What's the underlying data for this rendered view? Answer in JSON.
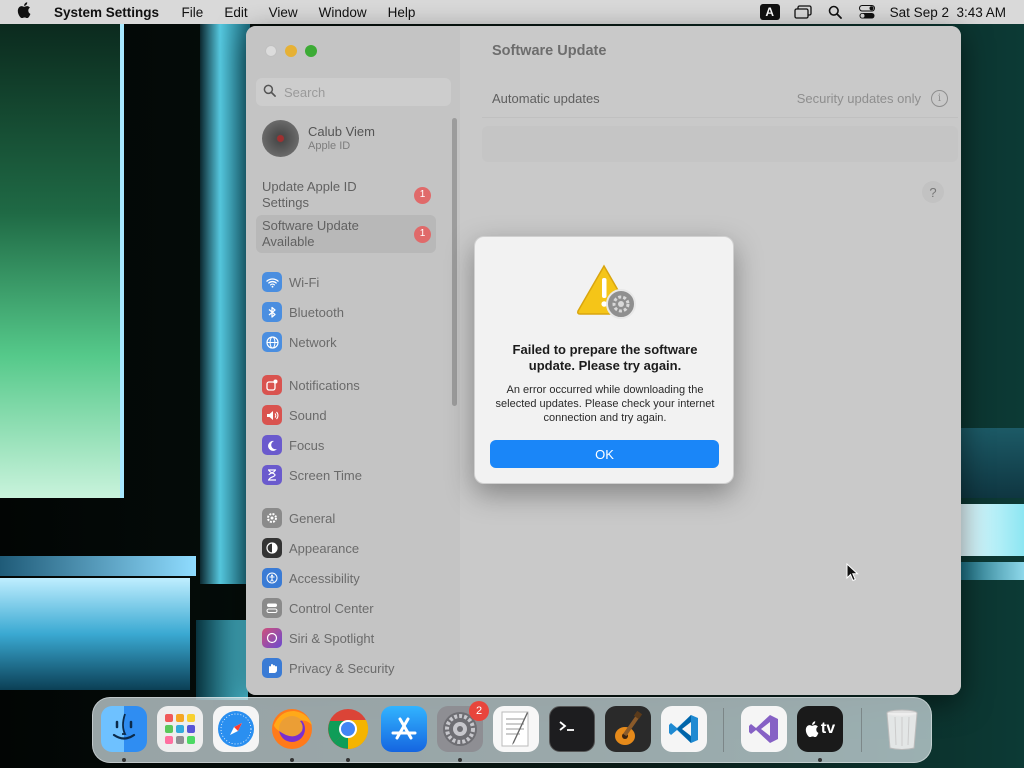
{
  "menubar": {
    "app_name": "System Settings",
    "menus": [
      "File",
      "Edit",
      "View",
      "Window",
      "Help"
    ],
    "input_source": "A",
    "clock": "Sat Sep 2  3:43 AM"
  },
  "sidebar": {
    "search_placeholder": "Search",
    "account": {
      "name": "Calub Viem",
      "subtitle": "Apple ID"
    },
    "alerts": [
      {
        "label_line1": "Update Apple ID",
        "label_line2": "Settings",
        "badge": "1"
      },
      {
        "label_line1": "Software Update",
        "label_line2": "Available",
        "badge": "1"
      }
    ],
    "group1": [
      {
        "label": "Wi-Fi",
        "icon": "wifi-icon",
        "color": "#4a8ee0"
      },
      {
        "label": "Bluetooth",
        "icon": "bluetooth-icon",
        "color": "#4a8ee0"
      },
      {
        "label": "Network",
        "icon": "network-icon",
        "color": "#4a8ee0"
      }
    ],
    "group2": [
      {
        "label": "Notifications",
        "icon": "notifications-icon",
        "color": "#d9534f"
      },
      {
        "label": "Sound",
        "icon": "sound-icon",
        "color": "#d9534f"
      },
      {
        "label": "Focus",
        "icon": "focus-icon",
        "color": "#6a5acd"
      },
      {
        "label": "Screen Time",
        "icon": "screen-time-icon",
        "color": "#6a5acd"
      }
    ],
    "group3": [
      {
        "label": "General",
        "icon": "general-icon",
        "color": "#8a8a8a"
      },
      {
        "label": "Appearance",
        "icon": "appearance-icon",
        "color": "#333333"
      },
      {
        "label": "Accessibility",
        "icon": "accessibility-icon",
        "color": "#3a7bd5"
      },
      {
        "label": "Control Center",
        "icon": "control-center-icon",
        "color": "#8a8a8a"
      },
      {
        "label": "Siri & Spotlight",
        "icon": "siri-icon",
        "color": "#b0508a"
      },
      {
        "label": "Privacy & Security",
        "icon": "privacy-icon",
        "color": "#3a7bd5"
      }
    ]
  },
  "main": {
    "title": "Software Update",
    "automatic_updates_label": "Automatic updates",
    "automatic_updates_value": "Security updates only",
    "help_label": "?"
  },
  "alert": {
    "title": "Failed to prepare the software update. Please try again.",
    "message": "An error occurred while downloading the selected updates. Please check your internet connection and try again.",
    "ok_label": "OK"
  },
  "dock": {
    "items": [
      {
        "name": "finder-icon",
        "running": true
      },
      {
        "name": "launchpad-icon",
        "running": false
      },
      {
        "name": "safari-icon",
        "running": false
      },
      {
        "name": "firefox-icon",
        "running": true
      },
      {
        "name": "chrome-icon",
        "running": true
      },
      {
        "name": "app-store-icon",
        "running": false
      },
      {
        "name": "system-settings-icon",
        "running": true,
        "badge": "2"
      },
      {
        "name": "textedit-icon",
        "running": false
      },
      {
        "name": "terminal-icon",
        "running": false
      },
      {
        "name": "garageband-icon",
        "running": false
      },
      {
        "name": "vscode-icon",
        "running": false
      },
      {
        "name": "visual-studio-icon",
        "running": false
      },
      {
        "name": "apple-tv-icon",
        "running": true,
        "label": "tv"
      },
      {
        "name": "trash-icon",
        "running": false
      }
    ]
  },
  "colors": {
    "accent": "#1a86f8",
    "badge_red": "#e06a6a",
    "warning_yellow": "#f5c518"
  }
}
